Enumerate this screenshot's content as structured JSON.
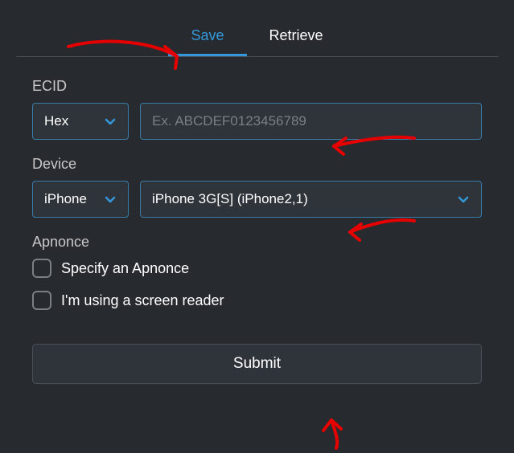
{
  "tabs": {
    "save": "Save",
    "retrieve": "Retrieve"
  },
  "ecid": {
    "label": "ECID",
    "format_selected": "Hex",
    "placeholder": "Ex. ABCDEF0123456789"
  },
  "device": {
    "label": "Device",
    "brand_selected": "iPhone",
    "model_selected": "iPhone 3G[S] (iPhone2,1)"
  },
  "apnonce": {
    "label": "Apnonce",
    "specify_label": "Specify an Apnonce"
  },
  "screen_reader_label": "I'm using a screen reader",
  "submit_label": "Submit"
}
